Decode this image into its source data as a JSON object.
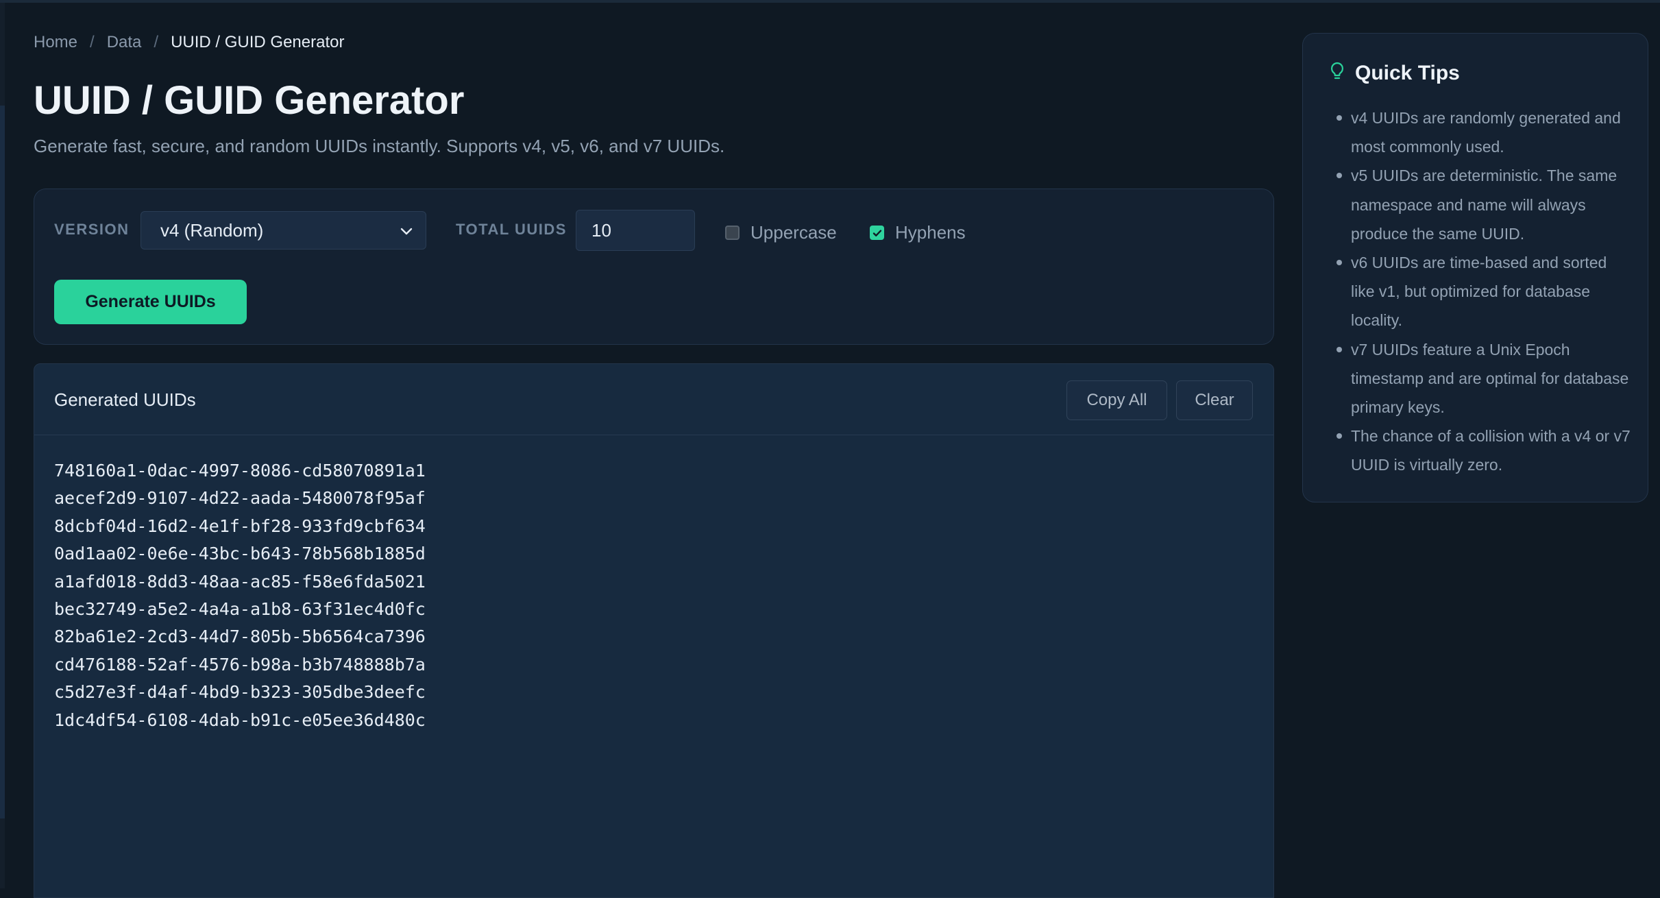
{
  "breadcrumb": {
    "home": "Home",
    "sep": "/",
    "data": "Data",
    "current": "UUID / GUID Generator"
  },
  "page": {
    "title": "UUID / GUID Generator",
    "subtitle": "Generate fast, secure, and random UUIDs instantly. Supports v4, v5, v6, and v7 UUIDs."
  },
  "controls": {
    "version_label": "VERSION",
    "version_value": "v4 (Random)",
    "total_label": "TOTAL UUIDS",
    "total_value": "10",
    "uppercase_label": "Uppercase",
    "uppercase_checked": false,
    "hyphens_label": "Hyphens",
    "hyphens_checked": true,
    "generate_label": "Generate UUIDs"
  },
  "output": {
    "title": "Generated UUIDs",
    "copy_all_label": "Copy All",
    "clear_label": "Clear",
    "uuids": [
      "748160a1-0dac-4997-8086-cd58070891a1",
      "aecef2d9-9107-4d22-aada-5480078f95af",
      "8dcbf04d-16d2-4e1f-bf28-933fd9cbf634",
      "0ad1aa02-0e6e-43bc-b643-78b568b1885d",
      "a1afd018-8dd3-48aa-ac85-f58e6fda5021",
      "bec32749-a5e2-4a4a-a1b8-63f31ec4d0fc",
      "82ba61e2-2cd3-44d7-805b-5b6564ca7396",
      "cd476188-52af-4576-b98a-b3b748888b7a",
      "c5d27e3f-d4af-4bd9-b323-305dbe3deefc",
      "1dc4df54-6108-4dab-b91c-e05ee36d480c"
    ]
  },
  "tips": {
    "title": "Quick Tips",
    "icon": "lightbulb-icon",
    "items": [
      "v4 UUIDs are randomly generated and most commonly used.",
      "v5 UUIDs are deterministic. The same namespace and name will always produce the same UUID.",
      "v6 UUIDs are time-based and sorted like v1, but optimized for database locality.",
      "v7 UUIDs feature a Unix Epoch timestamp and are optimal for database primary keys.",
      "The chance of a collision with a v4 or v7 UUID is virtually zero."
    ]
  },
  "colors": {
    "accent": "#2ad29b",
    "background": "#0f1923",
    "panel": "#142131"
  }
}
